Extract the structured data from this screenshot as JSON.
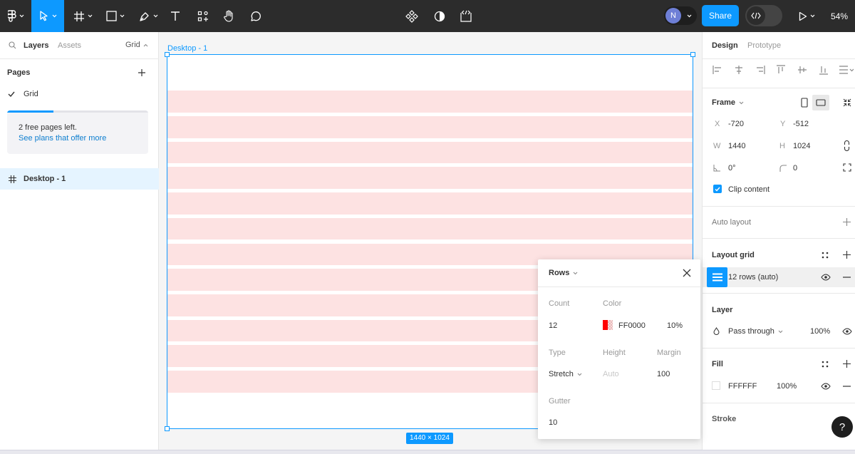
{
  "toolbar": {
    "avatar_initial": "N",
    "share_label": "Share",
    "zoom": "54%"
  },
  "left_panel": {
    "tabs": [
      "Layers",
      "Assets"
    ],
    "page_name": "Grid",
    "pages_heading": "Pages",
    "pages": [
      {
        "name": "Grid",
        "checked": true
      }
    ],
    "upsell_line1": "2 free pages left.",
    "upsell_link": "See plans that offer more",
    "upsell_progress_percent": 33,
    "layers": [
      {
        "name": "Desktop - 1"
      }
    ]
  },
  "canvas": {
    "frame_label": "Desktop - 1",
    "size_badge": "1440 × 1024",
    "grid_rows": 12,
    "grid_color": "#fde2e2",
    "selection_color": "#0d99ff"
  },
  "right_panel": {
    "tabs": [
      "Design",
      "Prototype"
    ],
    "frame": {
      "title": "Frame",
      "x_label": "X",
      "x": "-720",
      "y_label": "Y",
      "y": "-512",
      "w_label": "W",
      "w": "1440",
      "h_label": "H",
      "h": "1024",
      "rotation": "0°",
      "radius": "0",
      "clip_label": "Clip content",
      "clip_checked": true
    },
    "auto_layout_title": "Auto layout",
    "layout_grid": {
      "title": "Layout grid",
      "item": "12 rows (auto)"
    },
    "layer": {
      "title": "Layer",
      "blend": "Pass through",
      "opacity": "100%"
    },
    "fill": {
      "title": "Fill",
      "hex": "FFFFFF",
      "opacity": "100%"
    },
    "stroke_title": "Stroke"
  },
  "popover": {
    "title": "Rows",
    "count_label": "Count",
    "count": "12",
    "color_label": "Color",
    "color_hex": "FF0000",
    "color_opacity": "10%",
    "type_label": "Type",
    "type": "Stretch",
    "height_label": "Height",
    "height_placeholder": "Auto",
    "margin_label": "Margin",
    "margin": "100",
    "gutter_label": "Gutter",
    "gutter": "10"
  },
  "help_label": "?"
}
